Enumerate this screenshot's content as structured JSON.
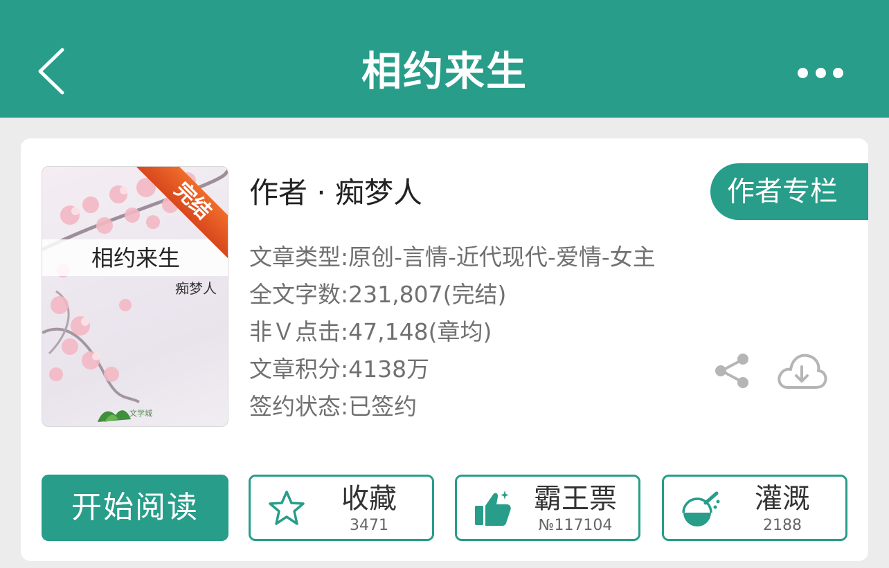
{
  "header": {
    "title": "相约来生",
    "back_icon": "chevron-left-icon",
    "more_icon": "more-dots-icon"
  },
  "cover": {
    "title": "相约来生",
    "author": "痴梦人",
    "status_ribbon": "完结",
    "logo_text": "文学城"
  },
  "book": {
    "author_line": "作者 · 痴梦人",
    "author_column_label": "作者专栏",
    "info": [
      "文章类型:原创-言情-近代现代-爱情-女主",
      "全文字数:231,807(完结)",
      "非Ｖ点击:47,148(章均)",
      "文章积分:4138万",
      "签约状态:已签约"
    ]
  },
  "actions": {
    "read_label": "开始阅读",
    "favorite": {
      "label": "收藏",
      "count": "3471",
      "icon": "star-icon"
    },
    "vote": {
      "label": "霸王票",
      "count": "№117104",
      "icon": "thumbs-up-icon"
    },
    "water": {
      "label": "灌溉",
      "count": "2188",
      "icon": "watering-flask-icon"
    },
    "share_icon": "share-icon",
    "download_icon": "cloud-download-icon"
  },
  "colors": {
    "brand": "#279d8a",
    "ribbon": "#e1561f",
    "info_text": "#707070",
    "background": "#ececec"
  }
}
